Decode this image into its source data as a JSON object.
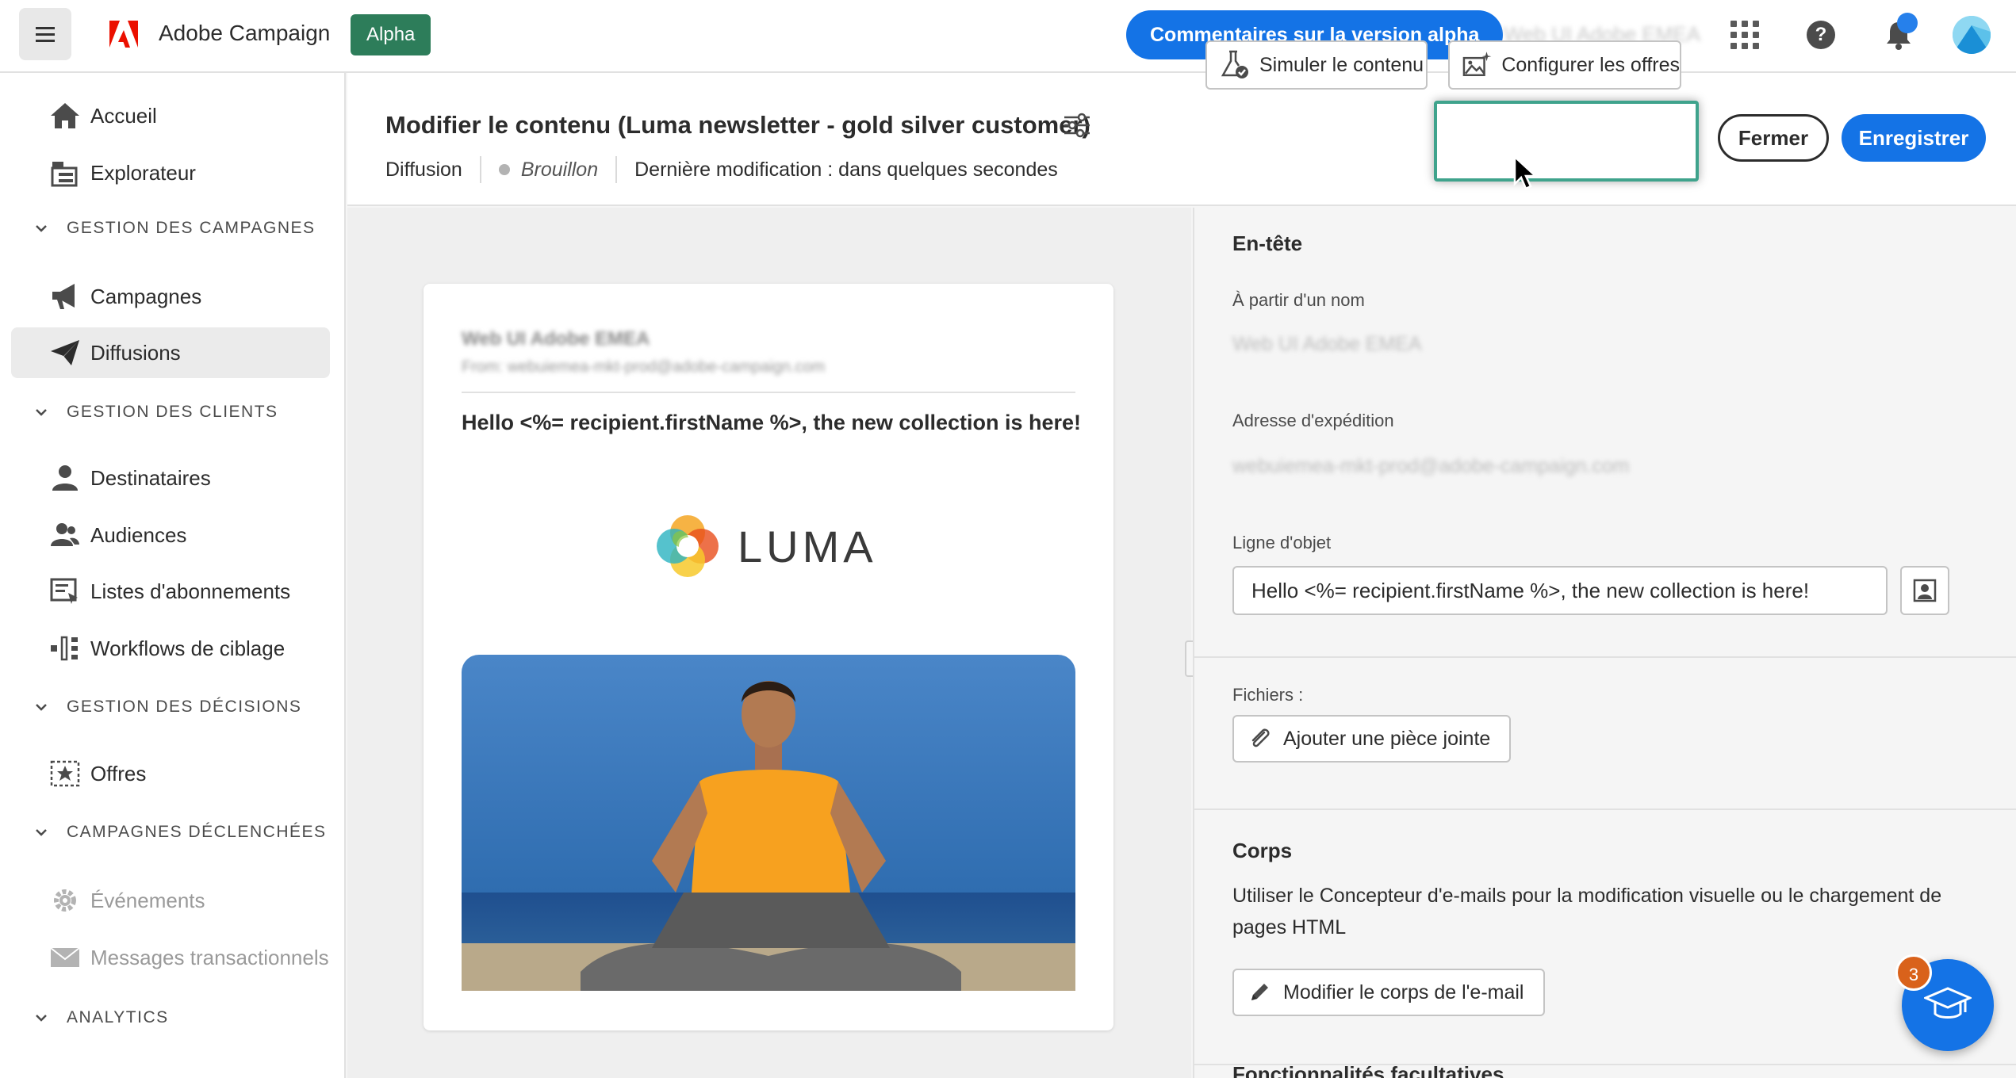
{
  "app": {
    "name": "Adobe Campaign",
    "badge": "Alpha",
    "feedback_button": "Commentaires sur la version alpha",
    "org_name": "Web UI Adobe EMEA",
    "notification_indicator": true
  },
  "sidebar": {
    "items": [
      {
        "label": "Accueil",
        "icon": "home-icon"
      },
      {
        "label": "Explorateur",
        "icon": "explorer-icon"
      }
    ],
    "sections": [
      {
        "title": "GESTION DES CAMPAGNES",
        "items": [
          {
            "label": "Campagnes",
            "icon": "megaphone-icon"
          },
          {
            "label": "Diffusions",
            "icon": "send-icon",
            "active": true
          }
        ]
      },
      {
        "title": "GESTION DES CLIENTS",
        "items": [
          {
            "label": "Destinataires",
            "icon": "user-icon"
          },
          {
            "label": "Audiences",
            "icon": "users-icon"
          },
          {
            "label": "Listes d'abonnements",
            "icon": "subscription-list-icon"
          },
          {
            "label": "Workflows de ciblage",
            "icon": "workflow-icon"
          }
        ]
      },
      {
        "title": "GESTION DES DÉCISIONS",
        "items": [
          {
            "label": "Offres",
            "icon": "offer-icon"
          }
        ]
      },
      {
        "title": "CAMPAGNES DÉCLENCHÉES",
        "items": [
          {
            "label": "Événements",
            "icon": "gear-icon",
            "disabled": true
          },
          {
            "label": "Messages  transactionnels",
            "icon": "mail-icon",
            "disabled": true
          }
        ]
      },
      {
        "title": "ANALYTICS",
        "items": []
      }
    ]
  },
  "header": {
    "title": "Modifier le contenu",
    "subtitle": "(Luma newsletter - gold silver customer)",
    "type": "Diffusion",
    "status": "Brouillon",
    "last_modified": "Dernière modification : dans quelques secondes",
    "simulate_button": "Simuler le contenu",
    "configure_offers_button": "Configurer les offres",
    "close_button": "Fermer",
    "save_button": "Enregistrer"
  },
  "preview": {
    "from_name": "Web UI Adobe EMEA",
    "from_address": "From: webuiemea-mkt-prod@adobe-campaign.com",
    "subject": "Hello <%= recipient.firstName %>, the new collection is here!",
    "logo_text": "LUMA"
  },
  "properties": {
    "header_section": "En-tête",
    "from_name_label": "À partir d'un nom",
    "from_name_value": "Web UI Adobe EMEA",
    "from_address_label": "Adresse d'expédition",
    "from_address_value": "webuiemea-mkt-prod@adobe-campaign.com",
    "subject_label": "Ligne d'objet",
    "subject_value": "Hello <%= recipient.firstName %>, the new collection is here!",
    "files_label": "Fichiers :",
    "add_attachment_button": "Ajouter une pièce jointe",
    "body_section": "Corps",
    "body_description": "Utiliser le Concepteur d'e-mails pour la modification visuelle ou le chargement de pages HTML",
    "edit_body_button": "Modifier le corps de l'e-mail",
    "optional_section": "Fonctionnalités facultatives"
  },
  "learn_fab": {
    "badge_count": "3"
  },
  "colors": {
    "accent": "#1473e6",
    "alpha": "#2d7d5a",
    "highlight": "#3fa38c"
  }
}
